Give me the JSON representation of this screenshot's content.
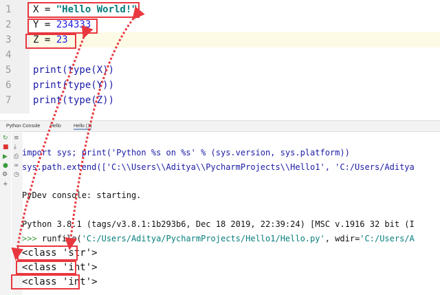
{
  "editor": {
    "line_numbers": [
      "1",
      "2",
      "3",
      "4",
      "5",
      "6",
      "7"
    ],
    "lines": [
      {
        "a": "X = ",
        "b": "\"Hello World!\""
      },
      {
        "a": "Y = ",
        "b": "234333"
      },
      {
        "a": "Z = ",
        "b": "23"
      },
      {
        "a": "",
        "b": ""
      },
      {
        "a": "print(type(X))",
        "b": ""
      },
      {
        "a": "print(type(Y))",
        "b": ""
      },
      {
        "a": "print(type(Z))",
        "b": ""
      }
    ]
  },
  "tabs": [
    "Python Console",
    "Hello",
    "Hello (1)"
  ],
  "console": {
    "import_line": "import sys; print('Python %s on %s' % (sys.version, sys.platform))",
    "path_line": "sys.path.extend(['C:\\\\Users\\\\Aditya\\\\PycharmProjects\\\\Hello1', 'C:/Users/Aditya",
    "starting": "PyDev console: starting.",
    "version": "Python 3.8.1 (tags/v3.8.1:1b293b6, Dec 18 2019, 22:39:24) [MSC v.1916 32 bit (I",
    "prompt": ">>> ",
    "runfile": "runfile(",
    "runfile_arg": "'C:/Users/Aditya/PycharmProjects/Hello1/Hello.py'",
    "runfile_rest": ", wdir=",
    "runfile_wdir": "'C:/Users/A",
    "outputs": [
      "<class 'str'>",
      "<class 'int'>",
      "<class 'int'>"
    ]
  },
  "colors": {
    "annotation": "#e8373e",
    "highlight": "#fdfbe5"
  }
}
